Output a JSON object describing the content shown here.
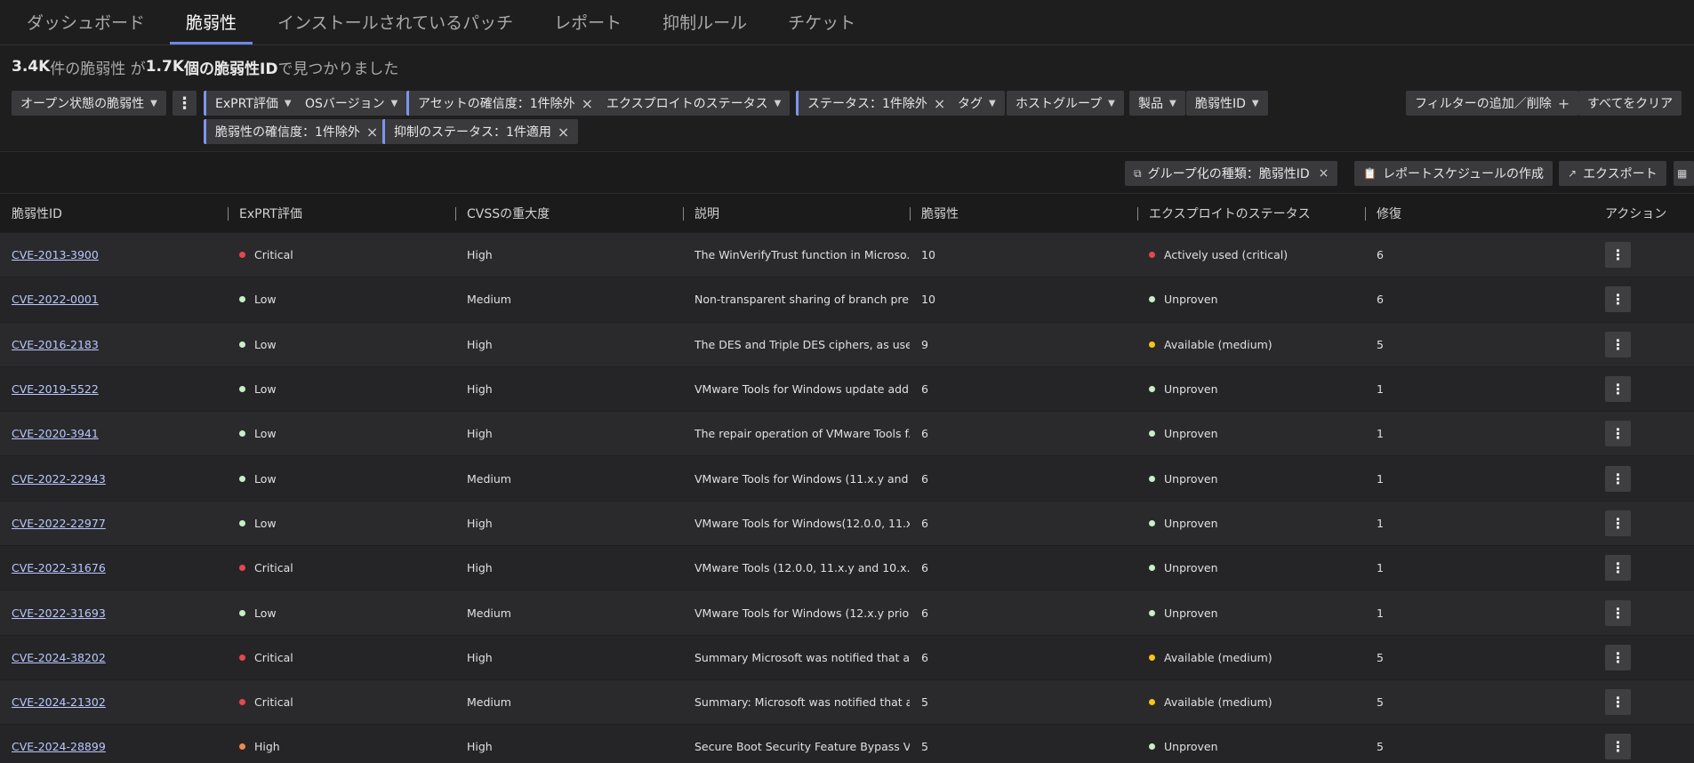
{
  "tabs": [
    {
      "label": "ダッシュボード",
      "active": false
    },
    {
      "label": "脆弱性",
      "active": true
    },
    {
      "label": "インストールされているパッチ",
      "active": false
    },
    {
      "label": "レポート",
      "active": false
    },
    {
      "label": "抑制ルール",
      "active": false
    },
    {
      "label": "チケット",
      "active": false
    }
  ],
  "summary": {
    "count_a": "3.4K",
    "text_a": "件の脆弱性 が ",
    "count_b": "1.7K",
    "text_b": "個の脆弱性ID",
    "text_c": " で見つかりました"
  },
  "filters": {
    "open_state": "オープン状態の脆弱性",
    "exprt": "ExPRT評価",
    "os_version": "OSバージョン",
    "asset_confidence": "アセットの確信度：1件除外",
    "exploit_status": "エクスプロイトのステータス",
    "status": "ステータス：1件除外",
    "tag": "タグ",
    "host_group": "ホストグループ",
    "product": "製品",
    "vuln_id": "脆弱性ID",
    "vuln_confidence": "脆弱性の確信度：1件除外",
    "suppress_status": "抑制のステータス：1件適用",
    "add_remove": "フィルターの追加／削除",
    "add_plus": "+",
    "clear_all": "すべてをクリア"
  },
  "toolbar": {
    "group_by": "グループ化の種類：脆弱性ID",
    "create_schedule": "レポートスケジュールの作成",
    "export": "エクスポート"
  },
  "columns": [
    "脆弱性ID",
    "ExPRT評価",
    "CVSSの重大度",
    "説明",
    "脆弱性",
    "エクスプロイトのステータス",
    "修復",
    "アクション"
  ],
  "colors": {
    "critical": "#e5484d",
    "low": "#c8f0c8",
    "high": "#f0874b",
    "medium_exploit": "#f5c518",
    "accent": "#6d87e6"
  },
  "rows": [
    {
      "id": "CVE-2013-3900",
      "exprt": "Critical",
      "exprt_color": "#e5484d",
      "cvss": "High",
      "desc": "The WinVerifyTrust function in Microso...",
      "count": "10",
      "exploit": "Actively used (critical)",
      "exploit_color": "#e5484d",
      "remed": "6"
    },
    {
      "id": "CVE-2022-0001",
      "exprt": "Low",
      "exprt_color": "#c8f0c8",
      "cvss": "Medium",
      "desc": "Non-transparent sharing of branch pre...",
      "count": "10",
      "exploit": "Unproven",
      "exploit_color": "#c8f0c8",
      "remed": "6"
    },
    {
      "id": "CVE-2016-2183",
      "exprt": "Low",
      "exprt_color": "#c8f0c8",
      "cvss": "High",
      "desc": "The DES and Triple DES ciphers, as use...",
      "count": "9",
      "exploit": "Available (medium)",
      "exploit_color": "#f5c518",
      "remed": "5"
    },
    {
      "id": "CVE-2019-5522",
      "exprt": "Low",
      "exprt_color": "#c8f0c8",
      "cvss": "High",
      "desc": "VMware Tools for Windows update add...",
      "count": "6",
      "exploit": "Unproven",
      "exploit_color": "#c8f0c8",
      "remed": "1"
    },
    {
      "id": "CVE-2020-3941",
      "exprt": "Low",
      "exprt_color": "#c8f0c8",
      "cvss": "High",
      "desc": "The repair operation of VMware Tools f...",
      "count": "6",
      "exploit": "Unproven",
      "exploit_color": "#c8f0c8",
      "remed": "1"
    },
    {
      "id": "CVE-2022-22943",
      "exprt": "Low",
      "exprt_color": "#c8f0c8",
      "cvss": "Medium",
      "desc": "VMware Tools for Windows (11.x.y and 1...",
      "count": "6",
      "exploit": "Unproven",
      "exploit_color": "#c8f0c8",
      "remed": "1"
    },
    {
      "id": "CVE-2022-22977",
      "exprt": "Low",
      "exprt_color": "#c8f0c8",
      "cvss": "High",
      "desc": "VMware Tools for Windows(12.0.0, 11.x.y...",
      "count": "6",
      "exploit": "Unproven",
      "exploit_color": "#c8f0c8",
      "remed": "1"
    },
    {
      "id": "CVE-2022-31676",
      "exprt": "Critical",
      "exprt_color": "#e5484d",
      "cvss": "High",
      "desc": "VMware Tools (12.0.0, 11.x.y and 10.x.y) ...",
      "count": "6",
      "exploit": "Unproven",
      "exploit_color": "#c8f0c8",
      "remed": "1"
    },
    {
      "id": "CVE-2022-31693",
      "exprt": "Low",
      "exprt_color": "#c8f0c8",
      "cvss": "Medium",
      "desc": "VMware Tools for Windows (12.x.y prior...",
      "count": "6",
      "exploit": "Unproven",
      "exploit_color": "#c8f0c8",
      "remed": "1"
    },
    {
      "id": "CVE-2024-38202",
      "exprt": "Critical",
      "exprt_color": "#e5484d",
      "cvss": "High",
      "desc": "Summary Microsoft was notified that a...",
      "count": "6",
      "exploit": "Available (medium)",
      "exploit_color": "#f5c518",
      "remed": "5"
    },
    {
      "id": "CVE-2024-21302",
      "exprt": "Critical",
      "exprt_color": "#e5484d",
      "cvss": "Medium",
      "desc": "Summary: Microsoft was notified that a...",
      "count": "5",
      "exploit": "Available (medium)",
      "exploit_color": "#f5c518",
      "remed": "5"
    },
    {
      "id": "CVE-2024-28899",
      "exprt": "High",
      "exprt_color": "#f0874b",
      "cvss": "High",
      "desc": "Secure Boot Security Feature Bypass V...",
      "count": "5",
      "exploit": "Unproven",
      "exploit_color": "#c8f0c8",
      "remed": "5"
    }
  ]
}
